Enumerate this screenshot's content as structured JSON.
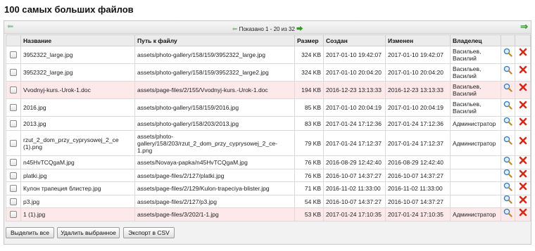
{
  "page": {
    "title": "100 самых больших файлов"
  },
  "pager": {
    "first_icon": "double-arrow-left-icon",
    "prev_icon": "arrow-left-icon",
    "text": "Показано 1 - 20 из 32",
    "next_icon": "arrow-right-icon",
    "last_icon": "double-arrow-right-icon"
  },
  "columns": [
    "",
    "Название",
    "Путь к файлу",
    "Размер",
    "Создан",
    "Изменен",
    "Владелец",
    "",
    ""
  ],
  "actions": {
    "view_icon": "magnifier-icon",
    "delete_icon": "delete-x-icon",
    "delete_color": "#d42a1a",
    "highlight_color": "#fde9ea"
  },
  "rows": [
    {
      "name": "3952322_large.jpg",
      "path": "assets/photo-gallery/158/159/3952322_large.jpg",
      "size": "324 KB",
      "created": "2017-01-10 19:42:07",
      "modified": "2017-01-10 19:42:07",
      "owner": "Васильев, Василий",
      "highlight": false
    },
    {
      "name": "3952322_large.jpg",
      "path": "assets/photo-gallery/158/159/3952322_large2.jpg",
      "size": "324 KB",
      "created": "2017-01-10 20:04:20",
      "modified": "2017-01-10 20:04:20",
      "owner": "Васильев, Василий",
      "highlight": false
    },
    {
      "name": "Vvodnyj-kurs.-Urok-1.doc",
      "path": "assets/page-files/2/155/Vvodnyj-kurs.-Urok-1.doc",
      "size": "194 KB",
      "created": "2016-12-23 13:13:33",
      "modified": "2016-12-23 13:13:33",
      "owner": "Васильев, Василий",
      "highlight": true
    },
    {
      "name": "2016.jpg",
      "path": "assets/photo-gallery/158/159/2016.jpg",
      "size": "85 KB",
      "created": "2017-01-10 20:04:19",
      "modified": "2017-01-10 20:04:19",
      "owner": "Васильев, Василий",
      "highlight": false
    },
    {
      "name": "2013.jpg",
      "path": "assets/photo-gallery/158/203/2013.jpg",
      "size": "83 KB",
      "created": "2017-01-24 17:12:36",
      "modified": "2017-01-24 17:12:36",
      "owner": "Администратор",
      "highlight": false
    },
    {
      "name": "rzut_2_dom_przy_cyprysowej_2_ce (1).png",
      "path": "assets/photo-gallery/158/203/rzut_2_dom_przy_cyprysowej_2_ce-1.png",
      "size": "79 KB",
      "created": "2017-01-24 17:12:37",
      "modified": "2017-01-24 17:12:37",
      "owner": "Администратор",
      "highlight": false
    },
    {
      "name": "n45HvTCQgaM.jpg",
      "path": "assets/Novaya-papka/n45HvTCQgaM.jpg",
      "size": "76 KB",
      "created": "2016-08-29 12:42:40",
      "modified": "2016-08-29 12:42:40",
      "owner": "",
      "highlight": false
    },
    {
      "name": "platki.jpg",
      "path": "assets/page-files/2/127/platki.jpg",
      "size": "76 KB",
      "created": "2016-10-07 14:37:27",
      "modified": "2016-10-07 14:37:27",
      "owner": "",
      "highlight": false
    },
    {
      "name": "Кулон трапеция блистер.jpg",
      "path": "assets/page-files/2/129/Kulon-trapeciya-blister.jpg",
      "size": "71 KB",
      "created": "2016-11-02 11:33:00",
      "modified": "2016-11-02 11:33:00",
      "owner": "",
      "highlight": false
    },
    {
      "name": "p3.jpg",
      "path": "assets/page-files/2/127/p3.jpg",
      "size": "54 KB",
      "created": "2016-10-07 14:37:27",
      "modified": "2016-10-07 14:37:27",
      "owner": "",
      "highlight": false
    },
    {
      "name": "1 (1).jpg",
      "path": "assets/page-files/3/202/1-1.jpg",
      "size": "53 KB",
      "created": "2017-01-24 17:10:35",
      "modified": "2017-01-24 17:10:35",
      "owner": "Администратор",
      "highlight": true
    }
  ],
  "footer": {
    "select_all": "Выделить все",
    "delete_selected": "Удалить выбранное",
    "export_csv": "Экспорт в CSV"
  }
}
